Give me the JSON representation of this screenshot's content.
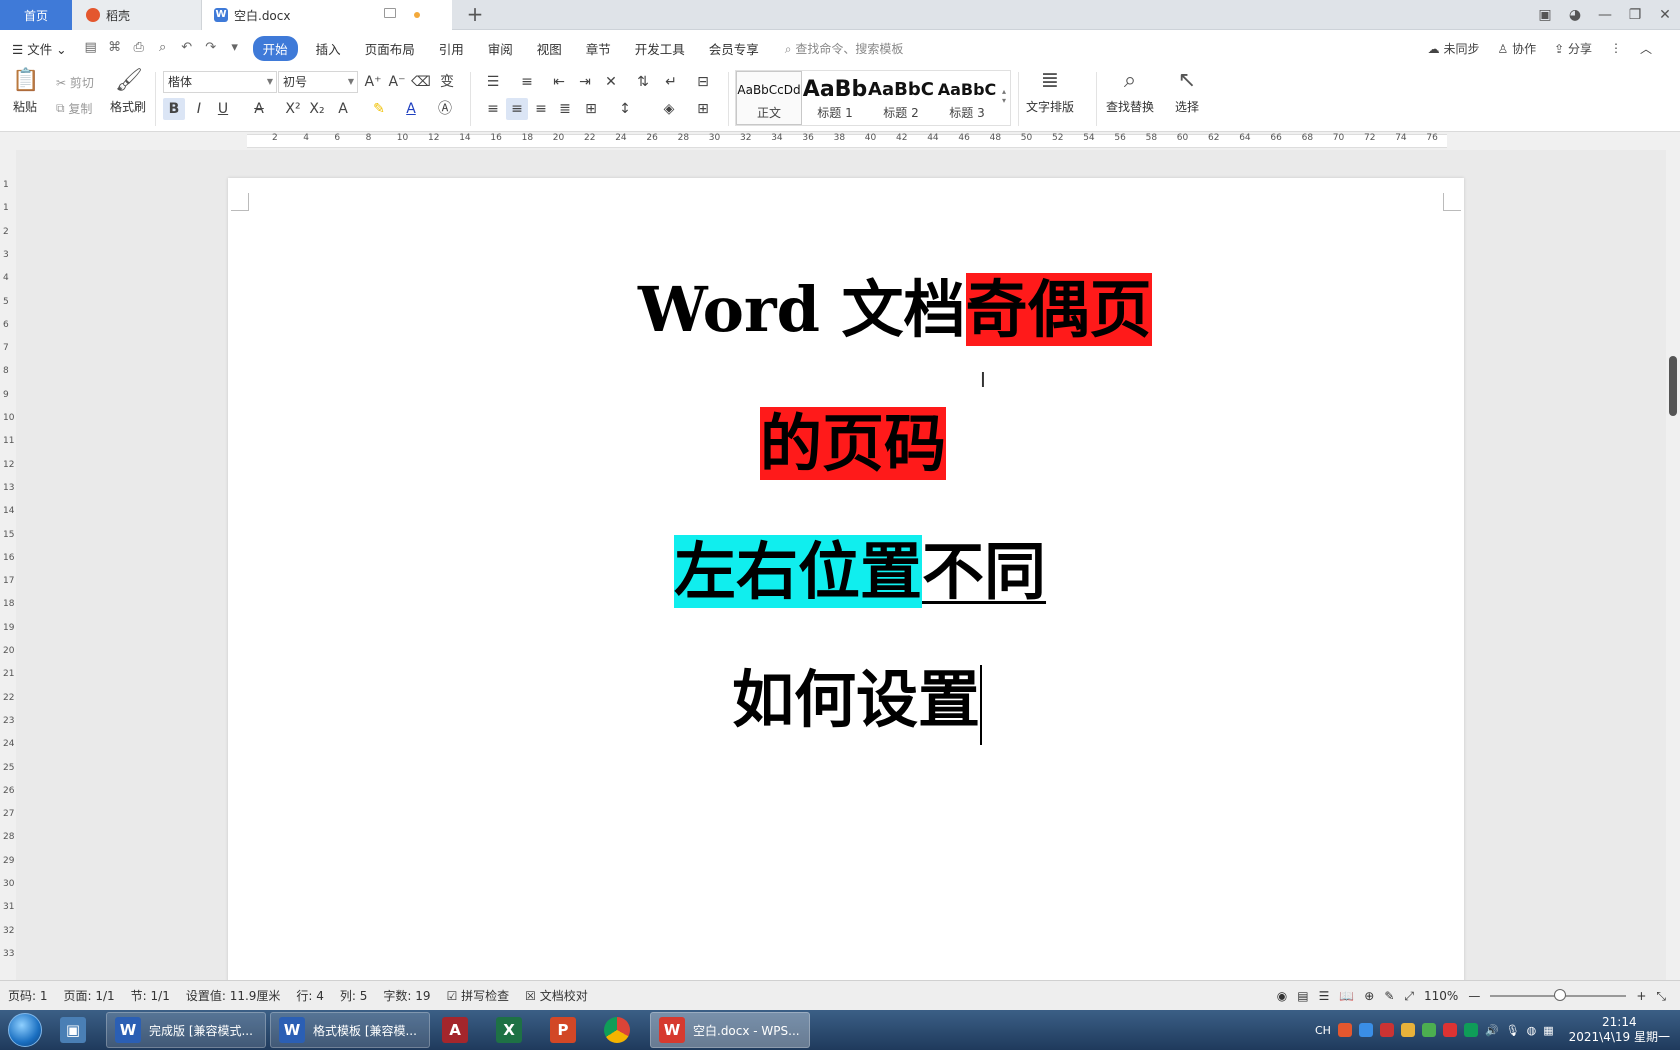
{
  "tabs": {
    "home": "首页",
    "daoke": "稻壳",
    "doc": "空白.docx",
    "new_tab": "+"
  },
  "menu": {
    "file": "文件",
    "items": [
      "开始",
      "插入",
      "页面布局",
      "引用",
      "审阅",
      "视图",
      "章节",
      "开发工具",
      "会员专享"
    ],
    "search_placeholder": "查找命令、搜索模板",
    "sync": "未同步",
    "collab": "协作",
    "share": "分享"
  },
  "ribbon": {
    "paste": "粘贴",
    "cut": "剪切",
    "copy": "复制",
    "format_painter": "格式刷",
    "font_name": "楷体",
    "font_size": "初号",
    "styles": [
      {
        "preview": "AaBbCcDd",
        "label": "正文"
      },
      {
        "preview": "AaBb",
        "label": "标题 1"
      },
      {
        "preview": "AaBbC",
        "label": "标题 2"
      },
      {
        "preview": "AaBbC",
        "label": "标题 3"
      }
    ],
    "text_layout": "文字排版",
    "find_replace": "查找替换",
    "select": "选择"
  },
  "ruler": {
    "h": [
      "2",
      "4",
      "6",
      "8",
      "10",
      "12",
      "14",
      "16",
      "18",
      "20",
      "22",
      "24",
      "26",
      "28",
      "30",
      "32",
      "34",
      "36",
      "38",
      "40",
      "42",
      "44",
      "46",
      "48",
      "50",
      "52",
      "54",
      "56",
      "58",
      "60",
      "62",
      "64",
      "66",
      "68",
      "70",
      "72",
      "74",
      "76"
    ],
    "v": [
      "1",
      "1",
      "2",
      "3",
      "4",
      "5",
      "6",
      "7",
      "8",
      "9",
      "10",
      "11",
      "12",
      "13",
      "14",
      "15",
      "16",
      "17",
      "18",
      "19",
      "20",
      "21",
      "22",
      "23",
      "24",
      "25",
      "26",
      "27",
      "28",
      "29",
      "30",
      "31",
      "32",
      "33"
    ]
  },
  "document": {
    "line1_a": "Word 文档",
    "line1_b": "奇偶页",
    "line2": "的页码",
    "line3_a": "左右位置",
    "line3_b": "不同",
    "line4": "如何设置",
    "colors": {
      "red_highlight": "#ff1a1a",
      "cyan_highlight": "#10eeee"
    }
  },
  "status": {
    "page_num": "页码: 1",
    "pages": "页面: 1/1",
    "section": "节: 1/1",
    "position": "设置值: 11.9厘米",
    "row": "行: 4",
    "col": "列: 5",
    "words": "字数: 19",
    "spell": "拼写检查",
    "proof": "文档校对",
    "zoom": "110%"
  },
  "taskbar": {
    "items": [
      "完成版 [兼容模式...",
      "格式模板 [兼容模..."
    ],
    "active": "空白.docx - WPS...",
    "ime": "CH",
    "time": "21:14",
    "date": "2021\\4\\19 星期一"
  }
}
